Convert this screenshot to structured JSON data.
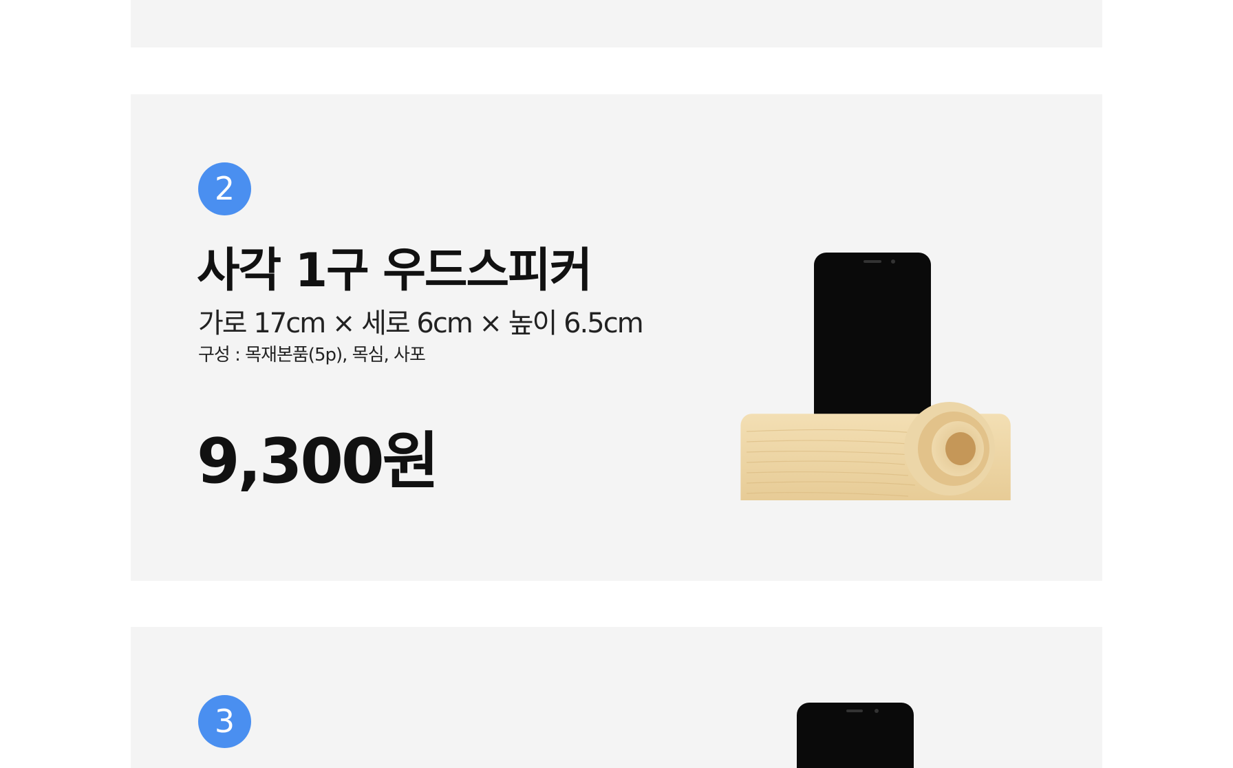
{
  "products": [
    {
      "number": "2",
      "title": "사각 1구 우드스피커",
      "dimensions": "가로 17cm × 세로 6cm × 높이 6.5cm",
      "composition": "구성 : 목재본품(5p), 목심, 사포",
      "price": "9,300원"
    },
    {
      "number": "3"
    }
  ],
  "colors": {
    "card_background": "#f4f4f4",
    "badge": "#4a8ff0",
    "text": "#111111"
  }
}
